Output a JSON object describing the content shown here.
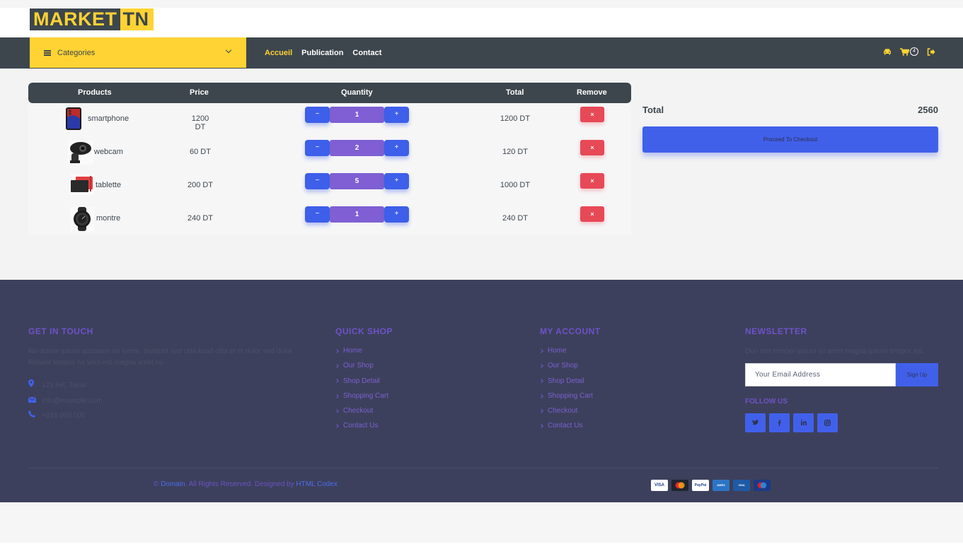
{
  "brand": {
    "part1": "MARKET",
    "part2": "TN",
    "yellow": "#ffd333",
    "dark": "#3d464d"
  },
  "navbar": {
    "categories_label": "Categories",
    "links": [
      {
        "label": "Accueil",
        "active": true
      },
      {
        "label": "Publication",
        "active": false
      },
      {
        "label": "Contact",
        "active": false
      }
    ],
    "icons": [
      "car-icon",
      "shopping-cart-icon",
      "sign-out-icon"
    ],
    "cart_count": "4"
  },
  "cart": {
    "headers": {
      "products": "Products",
      "price": "Price",
      "quantity": "Quantity",
      "total": "Total",
      "remove": "Remove"
    },
    "rows": [
      {
        "name": "smartphone",
        "price": "1200 DT",
        "qty": "1",
        "total": "1200 DT",
        "minus": "−",
        "plus": "+",
        "remove": "×"
      },
      {
        "name": "webcam",
        "price": "60 DT",
        "qty": "2",
        "total": "120 DT",
        "minus": "−",
        "plus": "+",
        "remove": "×"
      },
      {
        "name": "tablette",
        "price": "200 DT",
        "qty": "5",
        "total": "1000 DT",
        "minus": "−",
        "plus": "+",
        "remove": "×"
      },
      {
        "name": "montre",
        "price": "240 DT",
        "qty": "1",
        "total": "240 DT",
        "minus": "−",
        "plus": "+",
        "remove": "×"
      }
    ]
  },
  "summary": {
    "total_label": "Total",
    "total_value": "2560",
    "checkout_label": "Proceed To Checkout"
  },
  "footer": {
    "get_in_touch": {
      "title": "GET IN TOUCH",
      "text": "No dolore ipsum accusam no lorem. Invidunt sed clita kasd clita et et dolor sed dolor. Rebum tempor no vero est magna amet no",
      "address": "123 kef, Tunis",
      "email": "info@example.com",
      "phone": "+216 000 000"
    },
    "quick_shop": {
      "title": "QUICK SHOP",
      "links": [
        "Home",
        "Our Shop",
        "Shop Detail",
        "Shopping Cart",
        "Checkout",
        "Contact Us"
      ]
    },
    "my_account": {
      "title": "MY ACCOUNT",
      "links": [
        "Home",
        "Our Shop",
        "Shop Detail",
        "Shopping Cart",
        "Checkout",
        "Contact Us"
      ]
    },
    "newsletter": {
      "title": "NEWSLETTER",
      "text": "Duo stet tempor ipsum sit amet magna ipsum tempor est",
      "placeholder": "Your Email Address",
      "button": "Sign Up",
      "follow": "FOLLOW US",
      "socials": [
        "twitter-icon",
        "facebook-icon",
        "linkedin-icon",
        "instagram-icon"
      ]
    },
    "copyright": {
      "symbol": "©",
      "domain": "Domain",
      "middle": ". All Rights Reserved. Designed by",
      "designer": "HTML Codex"
    },
    "payments": [
      "VISA",
      "MasterCard",
      "PayPal",
      "AMEX",
      "VISA Electron",
      "Maestro"
    ]
  }
}
